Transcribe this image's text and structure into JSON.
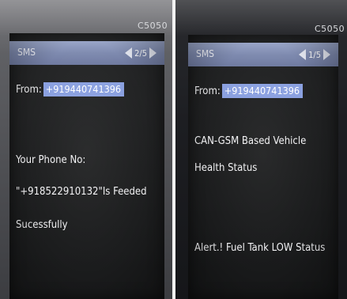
{
  "left_phone": {
    "brand": "C5050",
    "title": "SMS",
    "counter": "2/5",
    "from_label": "From:",
    "from_number": "+919440741396",
    "message_lines": [
      "Your Phone No:",
      "\"+918522910132\"Is Feeded",
      "Sucessfully"
    ]
  },
  "right_phone": {
    "brand": "C5050",
    "title": "SMS",
    "counter": "1/5",
    "from_label": "From:",
    "from_number": "+919440741396",
    "message_lines": [
      "CAN-GSM Based Vehicle",
      "Health Status",
      "Alert.! Fuel Tank LOW Status"
    ]
  },
  "colors": {
    "titlebar": "#7f8bb0",
    "number_highlight": "#8aa0e0",
    "screen_background": "#1e1f20"
  },
  "icons": [
    "arrow-left-icon",
    "arrow-right-icon"
  ]
}
